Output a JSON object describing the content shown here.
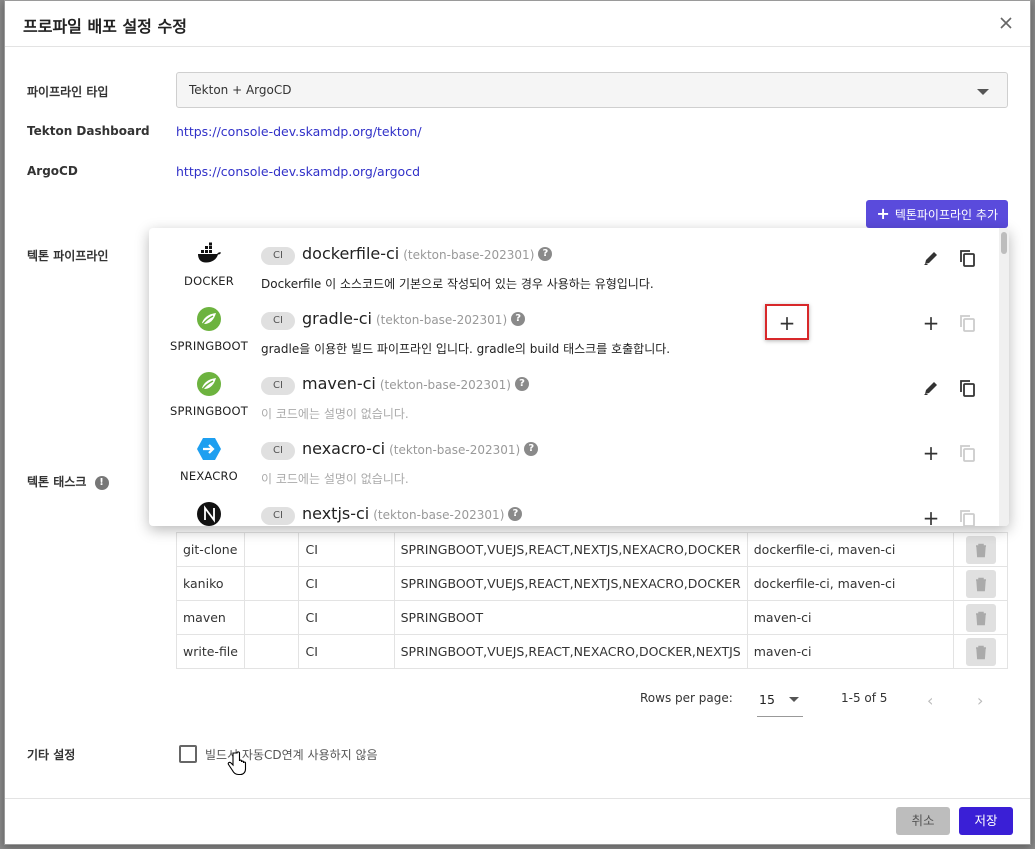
{
  "dialog": {
    "title": "프로파일 배포 설정 수정",
    "close_icon": "close-icon"
  },
  "form": {
    "pipeline_type_label": "파이프라인 타입",
    "pipeline_type_value": "Tekton + ArgoCD",
    "tekton_dashboard_label": "Tekton Dashboard",
    "tekton_dashboard_url": "https://console-dev.skamdp.org/tekton/",
    "argocd_label": "ArgoCD",
    "argocd_url": "https://console-dev.skamdp.org/argocd",
    "add_pipeline_button": "텍톤파이프라인 추가",
    "tekton_pipeline_label": "텍톤 파이프라인",
    "tekton_task_label": "텍톤 태스크",
    "other_settings_label": "기타 설정",
    "auto_cd_checkbox_label": "빌드시 자동CD연계 사용하지 않음"
  },
  "pipelines": [
    {
      "logo": "docker-icon",
      "logo_name": "DOCKER",
      "badge": "CI",
      "name": "dockerfile-ci",
      "version": "(tekton-base-202301)",
      "description": "Dockerfile 이 소스코드에 기본으로 작성되어 있는 경우 사용하는 유형입니다.",
      "action": "edit"
    },
    {
      "logo": "springboot-icon",
      "logo_name": "SPRINGBOOT",
      "badge": "CI",
      "name": "gradle-ci",
      "version": "(tekton-base-202301)",
      "description": "gradle을 이용한 빌드 파이프라인 입니다. gradle의 build 태스크를 호출합니다.",
      "action": "add"
    },
    {
      "logo": "springboot-icon",
      "logo_name": "SPRINGBOOT",
      "badge": "CI",
      "name": "maven-ci",
      "version": "(tekton-base-202301)",
      "description": "이 코드에는 설명이 없습니다.",
      "action": "edit"
    },
    {
      "logo": "nexacro-icon",
      "logo_name": "NEXACRO",
      "badge": "CI",
      "name": "nexacro-ci",
      "version": "(tekton-base-202301)",
      "description": "이 코드에는 설명이 없습니다.",
      "action": "add"
    },
    {
      "logo": "nextjs-icon",
      "logo_name": "",
      "badge": "CI",
      "name": "nextjs-ci",
      "version": "(tekton-base-202301)",
      "description": "",
      "action": "add"
    }
  ],
  "tasks": [
    {
      "name": "git-clone",
      "col2": "",
      "type": "CI",
      "platforms": "SPRINGBOOT,VUEJS,REACT,NEXTJS,NEXACRO,DOCKER",
      "pipelines": "dockerfile-ci, maven-ci"
    },
    {
      "name": "kaniko",
      "col2": "",
      "type": "CI",
      "platforms": "SPRINGBOOT,VUEJS,REACT,NEXTJS,NEXACRO,DOCKER",
      "pipelines": "dockerfile-ci, maven-ci"
    },
    {
      "name": "maven",
      "col2": "",
      "type": "CI",
      "platforms": "SPRINGBOOT",
      "pipelines": "maven-ci"
    },
    {
      "name": "write-file",
      "col2": "",
      "type": "CI",
      "platforms": "SPRINGBOOT,VUEJS,REACT,NEXACRO,DOCKER,NEXTJS",
      "pipelines": "maven-ci"
    }
  ],
  "pagination": {
    "rows_per_page_label": "Rows per page:",
    "rows_per_page_value": "15",
    "range_text": "1-5 of 5"
  },
  "footer": {
    "cancel_label": "취소",
    "save_label": "저장"
  },
  "colors": {
    "accent": "#5a4bdc",
    "save": "#3a1fd6",
    "link": "#3030c8",
    "highlight": "#d8282a"
  }
}
